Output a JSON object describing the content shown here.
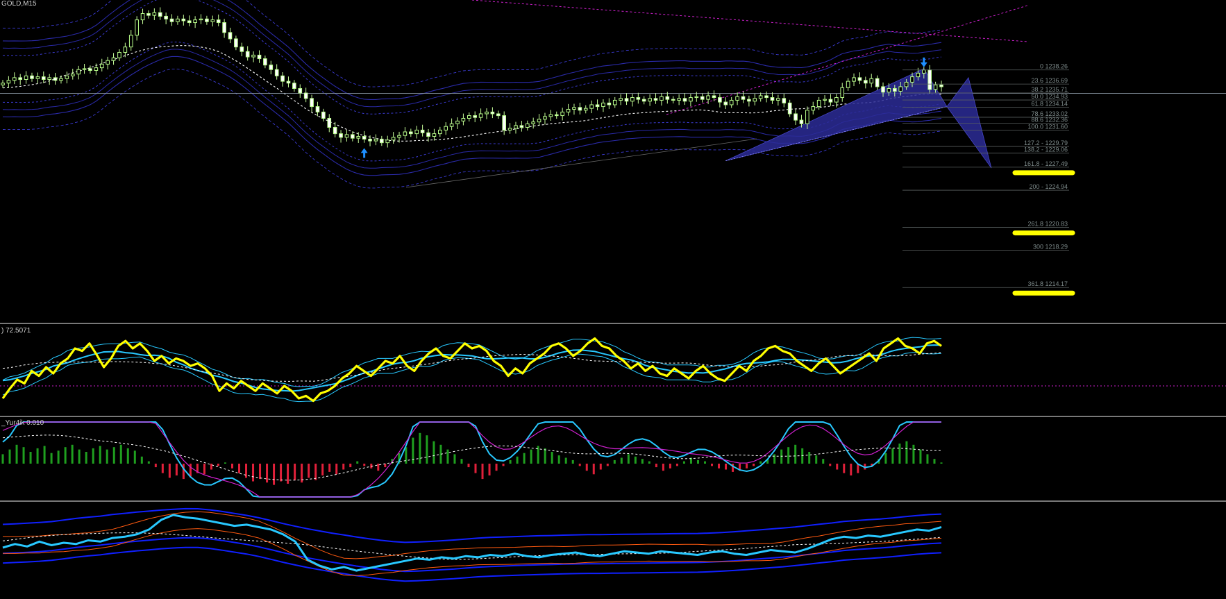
{
  "window": {
    "symbol_label": "GOLD,M15"
  },
  "panels": {
    "rsi_label": ") 72.5071",
    "macd_label": "_Yur4ik 0.010"
  },
  "colors": {
    "background": "#000000",
    "candle_bull": "#b9ff8a",
    "candle_bear": "#ffffff",
    "wick": "#c8ff9a",
    "band": "#2a2aa8",
    "band_dash": "#3a3ad0",
    "ma_white": "#ffffff",
    "magenta": "#d020d0",
    "pattern_fill": "#2b2b96",
    "arrow": "#1e90ff",
    "highlight": "#ffff00",
    "fib_line": "#5a6060",
    "separator": "#c0c0c0",
    "yellow_line": "#ffff00",
    "cyan_line": "#28c8ff",
    "hist_green": "#1f9f1f",
    "hist_red": "#e0203a",
    "blue_line": "#1020ff",
    "orange_line": "#ff5a10"
  },
  "chart_data": [
    {
      "type": "candlestick",
      "name": "",
      "title": "GOLD,M15",
      "grid": false,
      "fib_levels": [
        {
          "label": "0 1238.26",
          "value": 1238.26
        },
        {
          "label": "23.6 1236.69",
          "value": 1236.69
        },
        {
          "label": "38.2 1235.71",
          "value": 1235.71
        },
        {
          "label": "50.0 1234.93",
          "value": 1234.93
        },
        {
          "label": "61.8 1234.14",
          "value": 1234.14
        },
        {
          "label": "78.6 1233.02",
          "value": 1233.02
        },
        {
          "label": "88.6 1232.36",
          "value": 1232.36
        },
        {
          "label": "100.0 1231.60",
          "value": 1231.6
        },
        {
          "label": "127.2 - 1229.79",
          "value": 1229.79
        },
        {
          "label": "138.2 - 1229.06",
          "value": 1229.06
        },
        {
          "label": "161.8 - 1227.49",
          "value": 1227.49
        },
        {
          "label": "200 - 1224.94",
          "value": 1224.94
        },
        {
          "label": "261.8 1220.83",
          "value": 1220.83
        },
        {
          "label": "300 1218.29",
          "value": 1218.29
        },
        {
          "label": "361.8 1214.17",
          "value": 1214.17
        }
      ],
      "highlighted_levels": [
        1227.49,
        1220.83,
        1214.17
      ],
      "closes": [
        1236.8,
        1237.1,
        1237.4,
        1237.2,
        1237.6,
        1237.3,
        1237.5,
        1237.2,
        1237.4,
        1237.1,
        1237.3,
        1237.6,
        1237.8,
        1238.3,
        1238.4,
        1238.2,
        1238.5,
        1238.9,
        1239.3,
        1239.6,
        1240.2,
        1240.8,
        1242.1,
        1243.8,
        1244.5,
        1244.3,
        1244.6,
        1244.2,
        1243.9,
        1243.6,
        1243.9,
        1243.7,
        1243.5,
        1243.8,
        1243.9,
        1243.6,
        1243.8,
        1243.5,
        1242.4,
        1241.7,
        1240.8,
        1240.3,
        1239.7,
        1239.9,
        1239.5,
        1238.8,
        1238.3,
        1237.6,
        1237.0,
        1236.8,
        1236.2,
        1235.7,
        1235.1,
        1234.2,
        1233.6,
        1232.9,
        1231.9,
        1231.2,
        1230.8,
        1231.1,
        1230.7,
        1230.9,
        1230.6,
        1230.4,
        1230.6,
        1230.2,
        1230.5,
        1230.8,
        1231.0,
        1231.4,
        1231.2,
        1231.6,
        1231.3,
        1230.9,
        1231.2,
        1231.6,
        1232.0,
        1232.3,
        1232.6,
        1232.9,
        1233.2,
        1233.0,
        1233.4,
        1233.6,
        1233.4,
        1233.2,
        1231.6,
        1231.8,
        1232.1,
        1231.9,
        1232.3,
        1232.5,
        1232.8,
        1233.1,
        1233.3,
        1233.2,
        1233.6,
        1233.9,
        1234.1,
        1233.8,
        1234.0,
        1234.4,
        1234.2,
        1234.6,
        1234.4,
        1234.9,
        1235.1,
        1234.8,
        1235.2,
        1235.0,
        1234.8,
        1235.1,
        1234.9,
        1235.3,
        1235.0,
        1234.9,
        1235.1,
        1234.8,
        1235.2,
        1235.3,
        1235.0,
        1235.4,
        1235.2,
        1234.7,
        1234.4,
        1234.9,
        1235.3,
        1235.0,
        1234.8,
        1235.1,
        1235.4,
        1235.2,
        1234.9,
        1235.1,
        1234.6,
        1233.4,
        1232.7,
        1232.3,
        1233.8,
        1234.2,
        1234.9,
        1235.0,
        1234.7,
        1235.2,
        1236.3,
        1237.0,
        1237.4,
        1237.1,
        1236.8,
        1237.3,
        1236.4,
        1235.8,
        1236.2,
        1235.9,
        1236.4,
        1236.9,
        1237.5,
        1237.9,
        1238.26,
        1236.1,
        1236.6,
        1236.4
      ]
    },
    {
      "type": "line",
      "name": "RSI panel",
      "value_shown": 72.5071,
      "series": [
        {
          "name": "",
          "values": [
            30,
            38,
            45,
            42,
            52,
            48,
            55,
            50,
            58,
            62,
            70,
            68,
            74,
            65,
            55,
            62,
            72,
            76,
            70,
            74,
            68,
            60,
            64,
            58,
            62,
            60,
            56,
            58,
            54,
            48,
            36,
            42,
            38,
            44,
            40,
            36,
            42,
            38,
            34,
            40,
            36,
            30,
            32,
            28,
            34,
            36,
            40,
            46,
            50,
            56,
            52,
            48,
            54,
            60,
            58,
            64,
            56,
            52,
            60,
            66,
            70,
            64,
            62,
            68,
            74,
            70,
            72,
            68,
            60,
            56,
            48,
            54,
            50,
            58,
            62,
            66,
            72,
            74,
            70,
            64,
            68,
            74,
            78,
            72,
            70,
            64,
            60,
            54,
            58,
            52,
            56,
            50,
            48,
            54,
            50,
            46,
            52,
            56,
            50,
            46,
            44,
            50,
            56,
            52,
            60,
            64,
            70,
            72,
            68,
            66,
            60,
            56,
            52,
            58,
            62,
            56,
            50,
            54,
            58,
            62,
            66,
            60,
            70,
            74,
            78,
            72,
            70,
            66,
            74,
            76,
            72
          ]
        }
      ]
    },
    {
      "type": "bar",
      "name": "MACD panel",
      "value_shown": 0.01,
      "values": [
        0.8,
        1.2,
        1.6,
        1.4,
        1.0,
        1.3,
        1.5,
        0.9,
        1.1,
        1.4,
        1.6,
        1.2,
        1.0,
        1.3,
        1.5,
        1.2,
        1.4,
        1.6,
        1.3,
        1.1,
        0.6,
        0.2,
        -0.3,
        -0.8,
        -1.2,
        -1.0,
        -1.3,
        -1.1,
        -0.8,
        -0.9,
        -0.5,
        -0.2,
        0.1,
        -0.4,
        -0.8,
        -1.2,
        -1.5,
        -1.3,
        -1.6,
        -1.8,
        -1.5,
        -1.7,
        -1.4,
        -1.6,
        -1.2,
        -1.4,
        -1.0,
        -0.7,
        -0.9,
        -0.5,
        -0.3,
        0.2,
        -0.2,
        -0.4,
        -0.6,
        -0.3,
        0.4,
        0.9,
        1.4,
        2.2,
        2.6,
        2.4,
        1.9,
        1.6,
        1.2,
        0.8,
        0.4,
        -0.3,
        -0.8,
        -1.3,
        -1.0,
        -0.6,
        -0.2,
        0.3,
        0.6,
        0.9,
        1.2,
        1.5,
        1.3,
        1.0,
        0.7,
        0.5,
        0.3,
        -0.2,
        -0.6,
        -0.9,
        -0.5,
        -0.2,
        0.3,
        0.5,
        0.8,
        0.6,
        0.4,
        0.2,
        -0.3,
        -0.6,
        -0.4,
        -0.2,
        0.2,
        0.5,
        0.3,
        0.2,
        -0.2,
        -0.4,
        -0.5,
        -0.7,
        -0.6,
        -0.4,
        -0.2,
        0.2,
        0.4,
        0.8,
        1.2,
        1.4,
        1.6,
        1.3,
        1.0,
        0.7,
        0.4,
        -0.2,
        -0.5,
        -0.8,
        -1.0,
        -0.8,
        -0.5,
        -0.2,
        0.4,
        0.9,
        1.3,
        1.7,
        1.9,
        1.6,
        1.2,
        0.8,
        0.4,
        0.1
      ]
    },
    {
      "type": "line",
      "name": "Stochastic / CCI panel",
      "series": [
        {
          "name": "",
          "values": [
            55,
            58,
            56,
            60,
            57,
            59,
            58,
            61,
            60,
            63,
            64,
            66,
            70,
            78,
            82,
            80,
            79,
            77,
            75,
            73,
            74,
            72,
            70,
            66,
            60,
            45,
            40,
            37,
            39,
            36,
            38,
            40,
            42,
            44,
            46,
            45,
            47,
            46,
            48,
            47,
            49,
            48,
            50,
            48,
            47,
            49,
            50,
            51,
            49,
            48,
            50,
            52,
            51,
            50,
            52,
            51,
            50,
            49,
            51,
            52,
            50,
            49,
            51,
            53,
            52,
            51,
            54,
            58,
            62,
            64,
            63,
            65,
            64,
            66,
            68,
            70,
            69,
            72
          ]
        }
      ]
    }
  ]
}
